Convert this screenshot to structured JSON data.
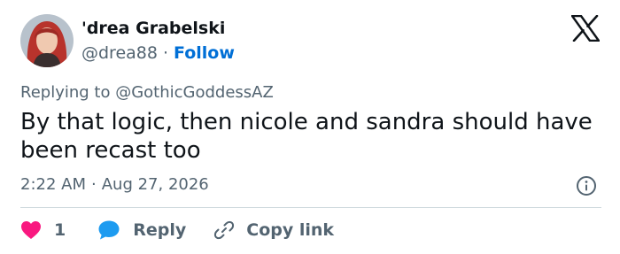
{
  "author": {
    "name": "'drea Grabelski",
    "handle": "@drea88",
    "follow_label": "Follow",
    "avatar_icon": "user-avatar-photo",
    "avatar_colors": [
      "#c0392b",
      "#8e1f1f"
    ]
  },
  "brand": {
    "icon": "x-logo-icon"
  },
  "reply_context": {
    "prefix": "Replying to",
    "mention": "@GothicGoddessAZ"
  },
  "tweet": {
    "text": "By that logic, then nicole and sandra should have been recast too"
  },
  "meta": {
    "time": "2:22 AM",
    "separator": "·",
    "date": "Aug 27, 2026",
    "info_icon": "info-icon"
  },
  "actions": {
    "like_count": "1",
    "reply_label": "Reply",
    "copy_label": "Copy link",
    "like_color": "#f91880",
    "reply_color": "#1d9bf0"
  }
}
